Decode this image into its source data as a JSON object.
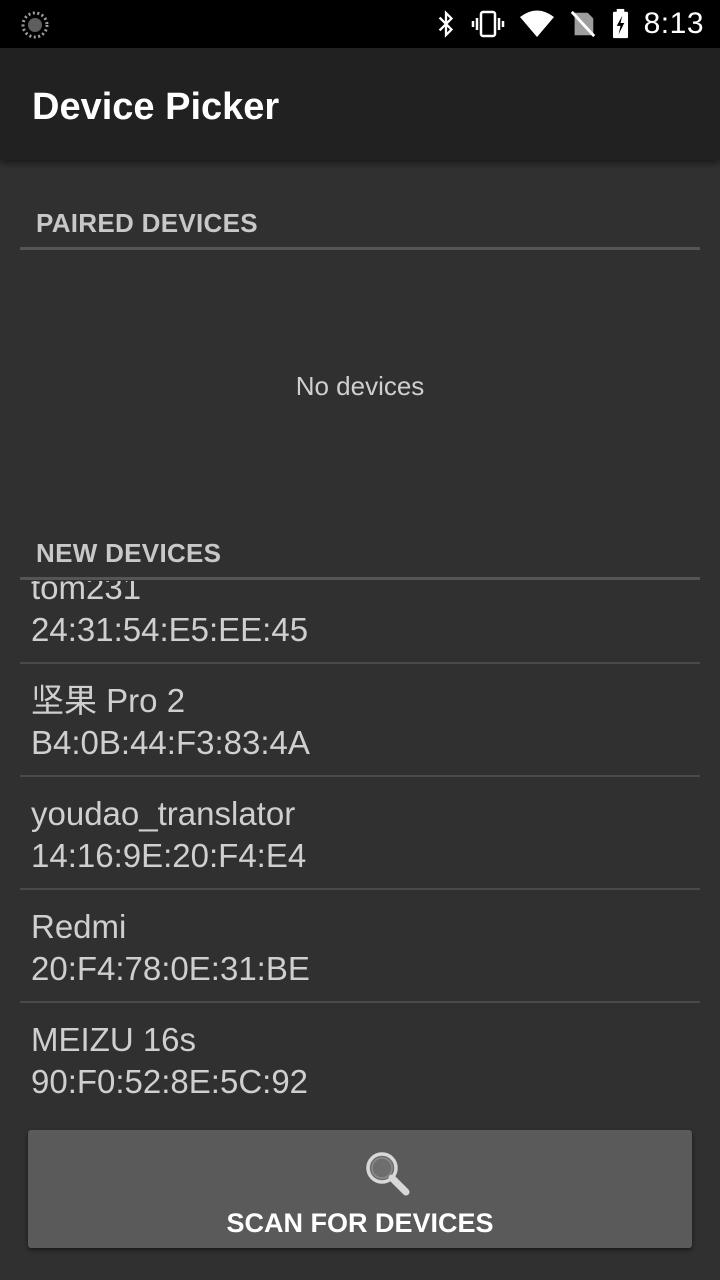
{
  "status_bar": {
    "time": "8:13",
    "icons": [
      "loading-icon",
      "bluetooth-icon",
      "vibrate-icon",
      "wifi-icon",
      "no-sim-icon",
      "battery-charging-icon"
    ]
  },
  "app_bar": {
    "title": "Device Picker"
  },
  "paired_section": {
    "header": "PAIRED DEVICES",
    "empty_text": "No devices"
  },
  "new_section": {
    "header": "NEW DEVICES",
    "devices": [
      {
        "name": "tom231",
        "address": "24:31:54:E5:EE:45"
      },
      {
        "name": "坚果 Pro 2",
        "address": "B4:0B:44:F3:83:4A"
      },
      {
        "name": "youdao_translator",
        "address": "14:16:9E:20:F4:E4"
      },
      {
        "name": "Redmi",
        "address": "20:F4:78:0E:31:BE"
      },
      {
        "name": "MEIZU 16s",
        "address": "90:F0:52:8E:5C:92"
      }
    ]
  },
  "scan_button": {
    "label": "SCAN FOR DEVICES",
    "icon": "search-icon"
  }
}
